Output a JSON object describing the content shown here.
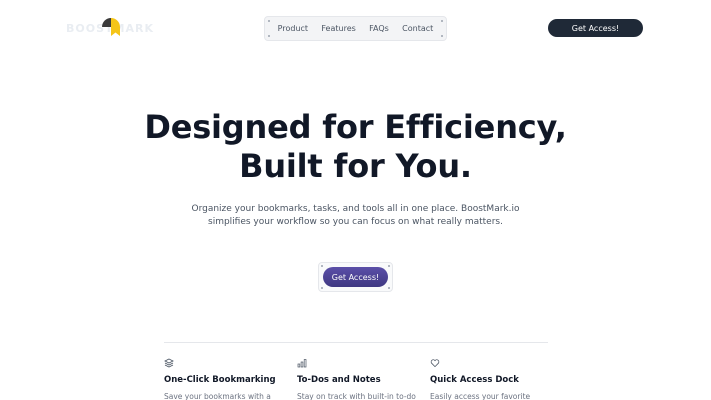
{
  "header": {
    "logo_text": "BOOSTMARK",
    "nav": [
      "Product",
      "Features",
      "FAQs",
      "Contact"
    ],
    "cta_label": "Get Access!"
  },
  "hero": {
    "title_line1": "Designed for Efficiency,",
    "title_line2": "Built for You.",
    "subtitle_line1": "Organize your bookmarks, tasks, and tools all in one place. BoostMark.io",
    "subtitle_line2": "simplifies your workflow so you can focus on what really matters.",
    "cta_label": "Get Access!"
  },
  "features": [
    {
      "icon": "layers-icon",
      "title": "One-Click Bookmarking",
      "desc": "Save your bookmarks with a"
    },
    {
      "icon": "bar-chart-icon",
      "title": "To-Dos and Notes",
      "desc": "Stay on track with built-in to-do"
    },
    {
      "icon": "heart-icon",
      "title": "Quick Access Dock",
      "desc": "Easily access your favorite"
    }
  ],
  "colors": {
    "primary_dark": "#1f2937",
    "accent_purple": "#4b4294",
    "logo_yellow": "#f5c518"
  }
}
